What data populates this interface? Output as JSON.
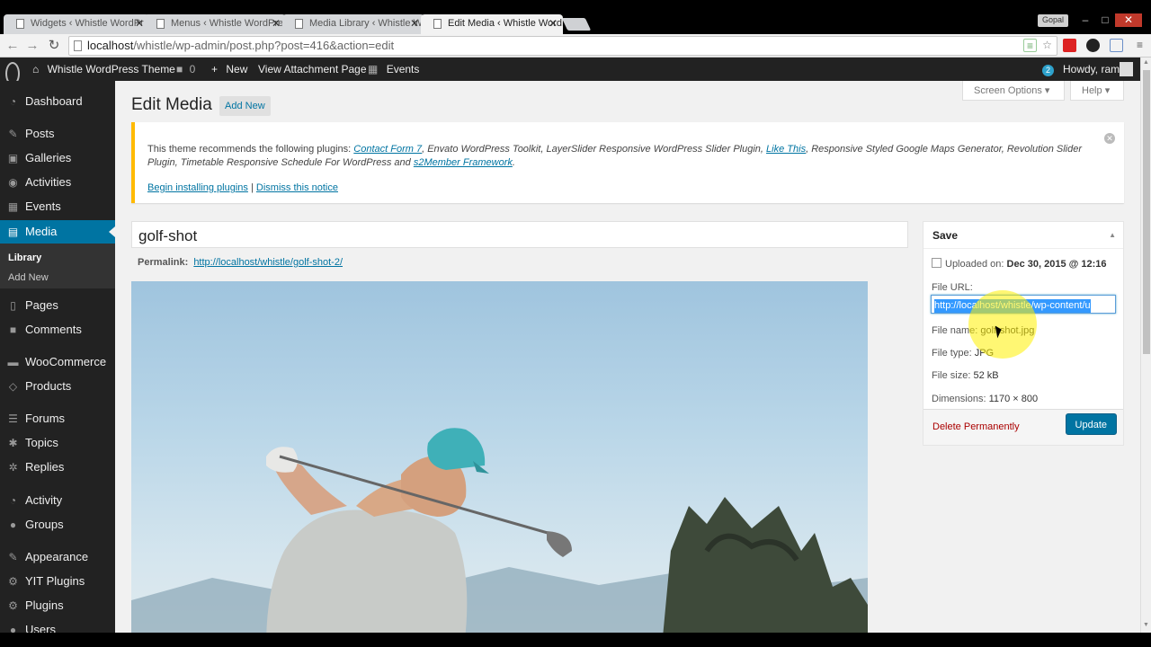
{
  "browser": {
    "tabs": [
      {
        "title": "Widgets ‹ Whistle WordPress Theme"
      },
      {
        "title": "Menus ‹ Whistle WordPress Theme"
      },
      {
        "title": "Media Library ‹ Whistle WordPress Theme"
      },
      {
        "title": "Edit Media ‹ Whistle WordPress Theme"
      }
    ],
    "close_glyph": "✕",
    "user_label": "Gopal",
    "address": {
      "host": "localhost",
      "path": "/whistle/wp-admin/post.php?post=416&action=edit"
    }
  },
  "adminbar": {
    "site_name": "Whistle WordPress Theme",
    "comments_count": "0",
    "new_label": "New",
    "view_attachment": "View Attachment Page",
    "events_label": "Events",
    "notifications_count": "2",
    "howdy": "Howdy, ram"
  },
  "sidebar": {
    "items": [
      {
        "label": "Dashboard",
        "icon": "dashboard-icon"
      },
      {
        "label": "Posts",
        "icon": "pin-icon"
      },
      {
        "label": "Galleries",
        "icon": "gallery-icon"
      },
      {
        "label": "Activities",
        "icon": "activity-icon"
      },
      {
        "label": "Events",
        "icon": "calendar-icon"
      },
      {
        "label": "Media",
        "icon": "media-icon"
      },
      {
        "label": "Pages",
        "icon": "page-icon"
      },
      {
        "label": "Comments",
        "icon": "comment-icon"
      },
      {
        "label": "WooCommerce",
        "icon": "woocommerce-icon"
      },
      {
        "label": "Products",
        "icon": "products-icon"
      },
      {
        "label": "Forums",
        "icon": "forums-icon"
      },
      {
        "label": "Topics",
        "icon": "topics-icon"
      },
      {
        "label": "Replies",
        "icon": "replies-icon"
      },
      {
        "label": "Activity",
        "icon": "activity-icon"
      },
      {
        "label": "Groups",
        "icon": "groups-icon"
      },
      {
        "label": "Appearance",
        "icon": "appearance-icon"
      },
      {
        "label": "YIT Plugins",
        "icon": "plugin-icon"
      },
      {
        "label": "Plugins",
        "icon": "plugin-icon"
      },
      {
        "label": "Users",
        "icon": "users-icon"
      }
    ],
    "submenu": {
      "library": "Library",
      "add_new": "Add New"
    }
  },
  "screen_options": "Screen Options",
  "help": "Help",
  "page": {
    "title": "Edit Media",
    "add_new": "Add New"
  },
  "notice": {
    "lead": "This theme recommends the following plugins:",
    "plugin_1": "Contact Form 7",
    "middle": ", Envato WordPress Toolkit, LayerSlider Responsive WordPress Slider Plugin,",
    "plugin_2": "Like This",
    "tail": ", Responsive Styled Google Maps Generator, Revolution Slider Plugin, Timetable Responsive Schedule For WordPress and",
    "plugin_3": "s2Member Framework",
    "end": ".",
    "begin_installing": "Begin installing plugins",
    "separator": "|",
    "dismiss": "Dismiss this notice"
  },
  "media": {
    "title": "golf-shot",
    "permalink_label": "Permalink:",
    "permalink_url": "http://localhost/whistle/golf-shot-2/"
  },
  "savebox": {
    "heading": "Save",
    "uploaded_label": "Uploaded on:",
    "uploaded_value": "Dec 30, 2015 @ 12:16",
    "file_url_label": "File URL:",
    "file_url_value": "http://localhost/whistle/wp-content/u",
    "file_name_label": "File name:",
    "file_name_value": "golf-shot.jpg",
    "file_type_label": "File type:",
    "file_type_value": "JPG",
    "file_size_label": "File size:",
    "file_size_value": "52 kB",
    "dimensions_label": "Dimensions:",
    "dimensions_value": "1170 × 800",
    "delete": "Delete Permanently",
    "update": "Update"
  },
  "colors": {
    "accent": "#0074a2",
    "adminbar": "#222222",
    "notice_border": "#ffba00"
  }
}
